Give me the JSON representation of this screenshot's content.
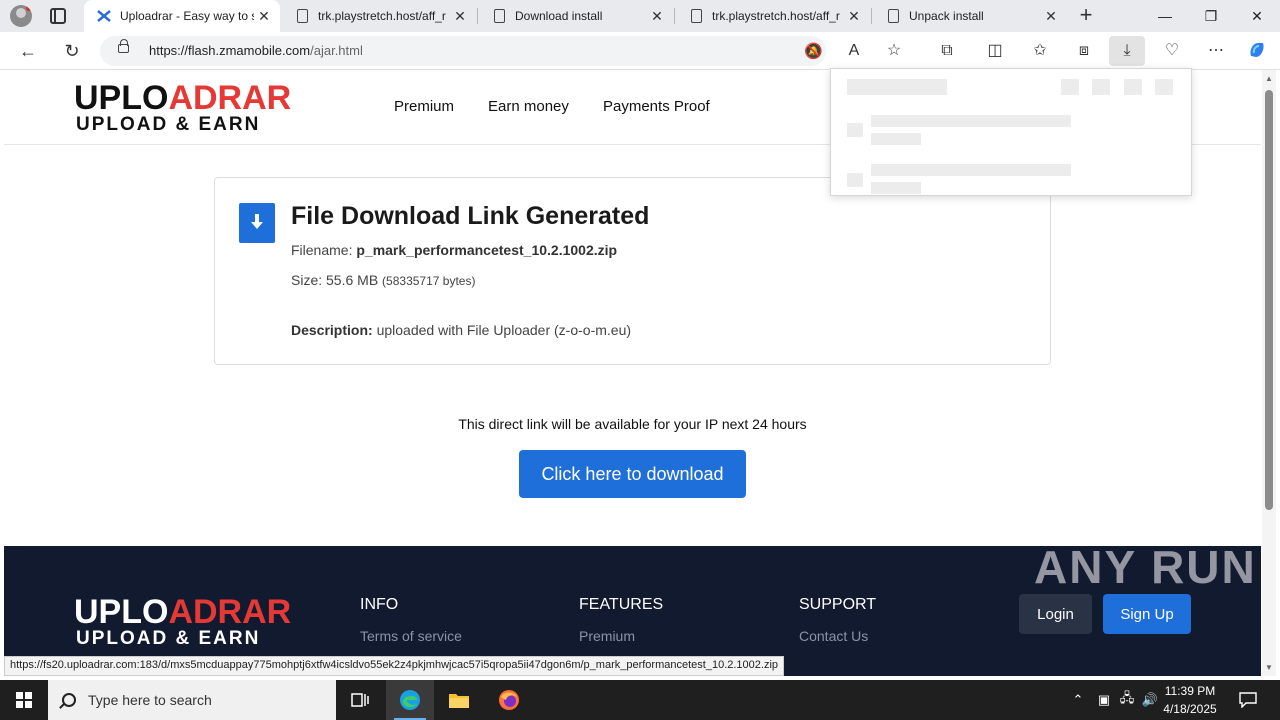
{
  "browser": {
    "tabs": [
      {
        "title": "Uploadrar - Easy way to s",
        "active": true
      },
      {
        "title": "trk.playstretch.host/aff_r",
        "active": false
      },
      {
        "title": "Download install",
        "active": false
      },
      {
        "title": "trk.playstretch.host/aff_r",
        "active": false
      },
      {
        "title": "Unpack install",
        "active": false
      }
    ],
    "address": {
      "host": "https://flash.zmamobile.com",
      "path": "/ajar.html"
    },
    "status_url": "https://fs20.uploadrar.com:183/d/mxs5mcduappay775mohptj6xtfw4icsldvo55ek2z4pkjmhwjcac57i5qropa5ii47dgon6m/p_mark_performancetest_10.2.1002.zip"
  },
  "site": {
    "logo": {
      "part1": "UPL",
      "part1b": "ADRAR",
      "tagline": "UPLOAD & EARN"
    },
    "nav": [
      "Premium",
      "Earn money",
      "Payments Proof"
    ],
    "card": {
      "title": "File Download Link Generated",
      "filename_label": "Filename:",
      "filename": "p_mark_performancetest_10.2.1002.zip",
      "size_label": "Size:",
      "size": "55.6 MB",
      "size_bytes": "(58335717 bytes)",
      "description_label": "Description:",
      "description": "uploaded with File Uploader (z-o-o-m.eu)"
    },
    "availability_note": "This direct link will be available for your IP next 24 hours",
    "download_button": "Click here to download",
    "footer": {
      "columns": [
        {
          "heading": "INFO",
          "link": "Terms of service"
        },
        {
          "heading": "FEATURES",
          "link": "Premium"
        },
        {
          "heading": "SUPPORT",
          "link": "Contact Us"
        }
      ],
      "login": "Login",
      "signup": "Sign Up"
    },
    "watermark": "ANY RUN"
  },
  "taskbar": {
    "search_placeholder": "Type here to search",
    "time": "11:39 PM",
    "date": "4/18/2025"
  },
  "colors": {
    "accent": "#1e6fd9",
    "logo_red": "#e53935",
    "footer_bg": "#121a30"
  }
}
